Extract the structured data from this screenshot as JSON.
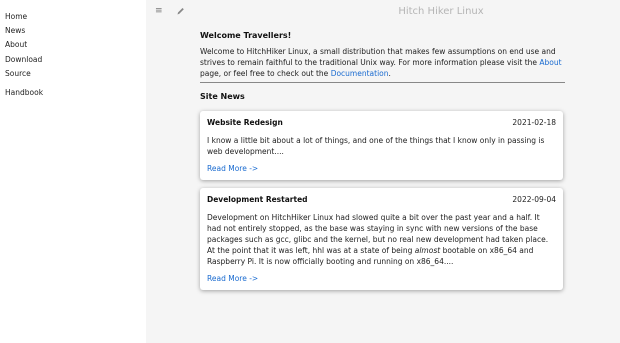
{
  "sidebar": {
    "items": [
      "Home",
      "News",
      "About",
      "Download",
      "Source"
    ],
    "extra": [
      "Handbook"
    ]
  },
  "topbar": {
    "menu_icon": "hamburger-menu-icon",
    "edit_icon": "pencil-icon",
    "site_title": "Hitch Hiker Linux"
  },
  "welcome": {
    "heading": "Welcome Travellers!",
    "text_before_about": "Welcome to HitchHiker Linux, a small distribution that makes few assumptions on end use and strives to remain faithful to the traditional Unix way. For more information please visit the ",
    "about_link": "About",
    "text_middle": " page, or feel free to check out the ",
    "docs_link": "Documentation",
    "text_end": "."
  },
  "news": {
    "heading": "Site News",
    "posts": [
      {
        "title": "Website Redesign",
        "date": "2021-02-18",
        "body": "I know a little bit about a lot of things, and one of the things that I know only in passing is web development....",
        "more": "Read More ->"
      },
      {
        "title": "Development Restarted",
        "date": "2022-09-04",
        "body_before": "Development on HitchHiker Linux had slowed quite a bit over the past year and a half. It had not entirely stopped, as the base was staying in sync with new versions of the base packages such as gcc, glibc and the kernel, but no real new development had taken place. At the point that it was left, hhl was at a state of being ",
        "body_em": "almost",
        "body_after": " bootable on x86_64 and Raspberry Pi. It is now officially booting and running on x86_64....",
        "more": "Read More ->"
      }
    ]
  }
}
